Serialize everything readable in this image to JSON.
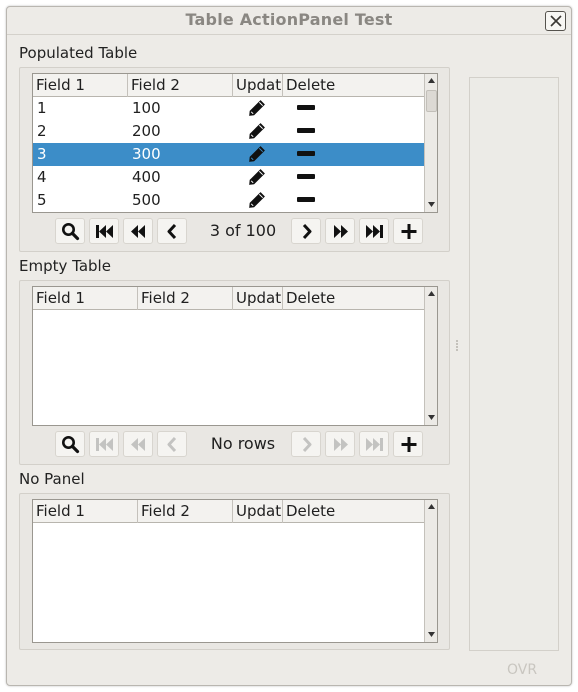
{
  "window": {
    "title": "Table ActionPanel Test",
    "close_glyph": "✕"
  },
  "sections": [
    {
      "label": "Populated Table",
      "columns": [
        "Field 1",
        "Field 2",
        "Updat",
        "Delete"
      ],
      "rows": [
        {
          "f1": "1",
          "f2": "100",
          "selected": false
        },
        {
          "f1": "2",
          "f2": "200",
          "selected": false
        },
        {
          "f1": "3",
          "f2": "300",
          "selected": true
        },
        {
          "f1": "4",
          "f2": "400",
          "selected": false
        },
        {
          "f1": "5",
          "f2": "500",
          "selected": false
        }
      ],
      "pager_text": "3 of 100",
      "nav_enabled": true
    },
    {
      "label": "Empty Table",
      "columns": [
        "Field 1",
        "Field 2",
        "Updat",
        "Delete"
      ],
      "rows": [],
      "pager_text": "No rows",
      "nav_enabled": false
    },
    {
      "label": "No Panel",
      "columns": [
        "Field 1",
        "Field 2",
        "Updat",
        "Delete"
      ],
      "rows": []
    }
  ],
  "toolbar_icons": [
    "search-icon",
    "first-page-icon",
    "previous-page-icon",
    "previous-icon",
    "next-icon",
    "next-page-icon",
    "last-page-icon",
    "add-icon"
  ],
  "row_icons": {
    "update": "pencil-icon",
    "delete": "minus-icon"
  },
  "status": {
    "mode": "OVR"
  },
  "colors": {
    "selection": "#3c8dc8",
    "window_bg": "#edebe7"
  }
}
